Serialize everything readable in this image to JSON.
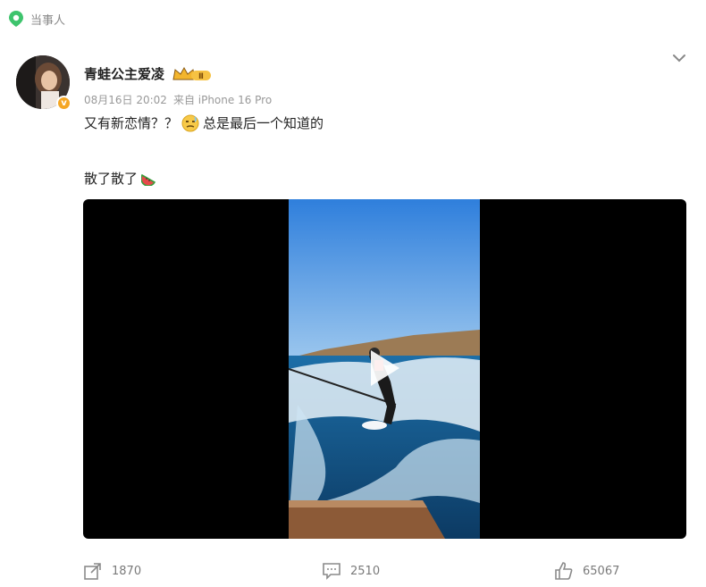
{
  "header_tag": {
    "label": "当事人",
    "icon": "location-pin-icon"
  },
  "post": {
    "author_name": "青蛙公主爱凌",
    "verified_icon": "verified-badge-icon",
    "member_badge": "crown-level-badge",
    "date": "08月16日 20:02",
    "source": "来自 iPhone 16 Pro",
    "line1_before_emoji": "又有新恋情？？",
    "line1_after_emoji": "总是最后一个知道的",
    "line2": "散了散了",
    "emoji1": "awkward-face-icon",
    "emoji2": "watermelon-icon"
  },
  "video": {
    "description": "surfer wake surfing behind a boat under blue sky",
    "play_icon": "play-icon"
  },
  "actions": {
    "share_count": "1870",
    "comment_count": "2510",
    "like_count": "65067"
  },
  "colors": {
    "accent": "#f5a623",
    "muted": "#999999",
    "location_green": "#3ec46d"
  }
}
